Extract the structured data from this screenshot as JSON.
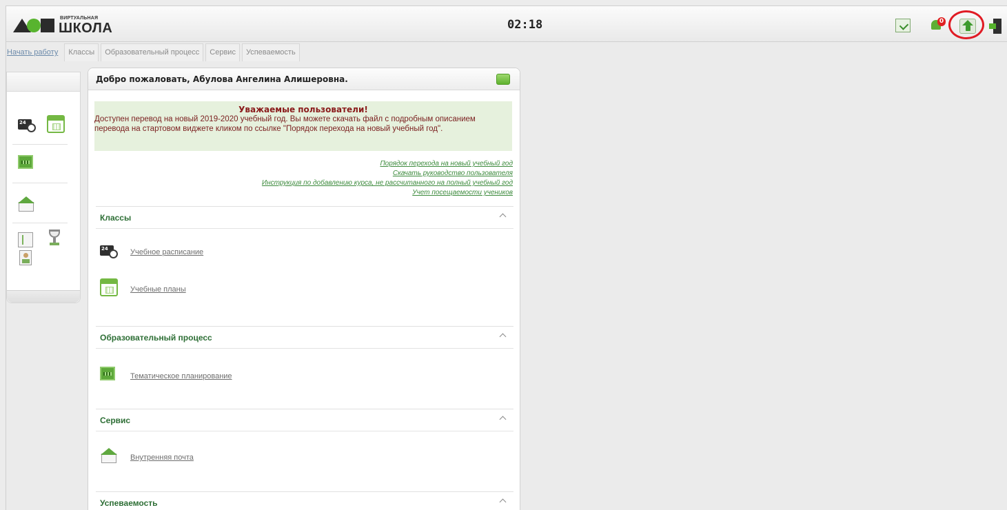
{
  "header": {
    "logo_small": "ВИРТУАЛЬНАЯ",
    "logo_big": "ШКОЛА",
    "clock": "02:18",
    "notification_count": "0",
    "accent_color": "#58b42f",
    "highlight_color": "#e01b24"
  },
  "tabs": [
    {
      "label": "Начать работу"
    },
    {
      "label": "Классы"
    },
    {
      "label": "Образовательный процесс"
    },
    {
      "label": "Сервис"
    },
    {
      "label": "Успеваемость"
    }
  ],
  "main": {
    "welcome": "Добро пожаловать, Абулова Ангелина Алишеровна.",
    "notice_title": "Уважаемые пользователи!",
    "notice_text": "Доступен перевод на новый 2019-2020 учебный год. Вы можете скачать файл с подробным описанием перевода на стартовом виджете кликом по ссылке \"Порядок перехода на новый учебный год\".",
    "links": [
      "Порядок перехода на новый учебный год",
      "Скачать руководство пользователя",
      "Инструкция по добавлению курса, не рассчитанного на полный учебный год",
      "Учет посещаемости учеников"
    ],
    "sections": [
      {
        "title": "Классы",
        "items": [
          "Учебное расписание",
          "Учебные планы"
        ]
      },
      {
        "title": "Образовательный процесс",
        "items": [
          "Тематическое планирование"
        ]
      },
      {
        "title": "Сервис",
        "items": [
          "Внутренняя почта"
        ]
      },
      {
        "title": "Успеваемость",
        "items": []
      }
    ]
  }
}
